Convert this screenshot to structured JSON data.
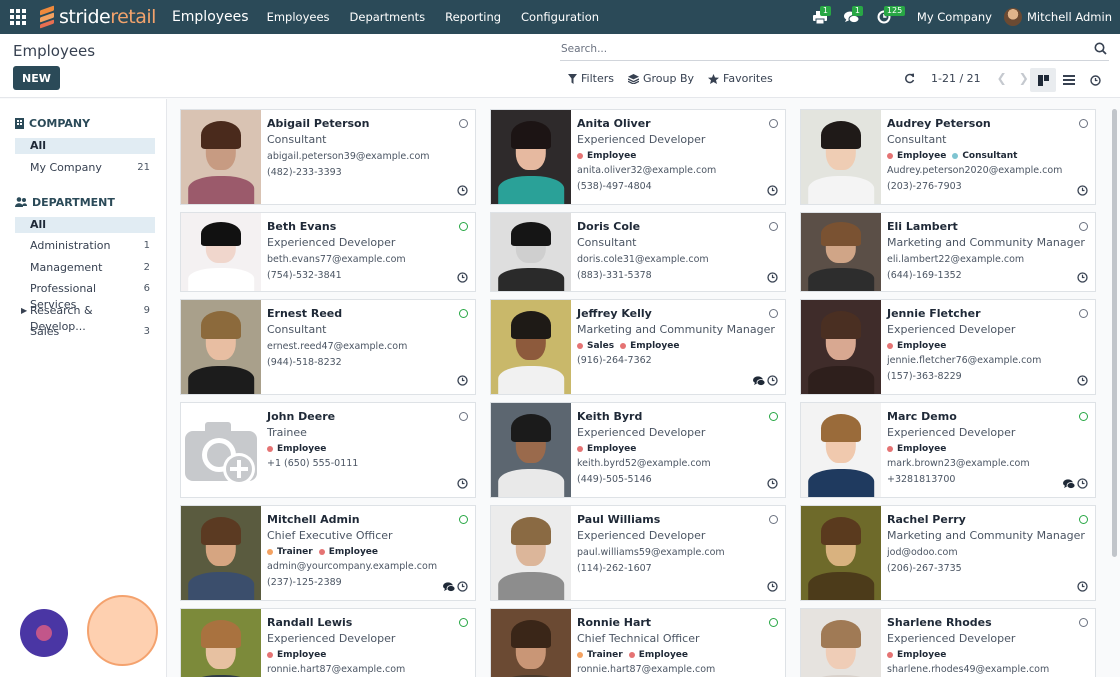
{
  "navbar": {
    "brand_a": "stride",
    "brand_b": "retail",
    "app_name": "Employees",
    "menu": [
      "Employees",
      "Departments",
      "Reporting",
      "Configuration"
    ],
    "badges": {
      "printer": "1",
      "messages": "1",
      "activities": "125"
    },
    "company": "My Company",
    "user": "Mitchell Admin"
  },
  "control_panel": {
    "breadcrumb": "Employees",
    "new_label": "NEW",
    "search_placeholder": "Search...",
    "filters_label": "Filters",
    "group_by_label": "Group By",
    "favorites_label": "Favorites",
    "pager_value": "1-21 / 21"
  },
  "sidebar": {
    "company": {
      "title": "COMPANY",
      "items": [
        {
          "label": "All",
          "count": ""
        },
        {
          "label": "My Company",
          "count": "21"
        }
      ]
    },
    "department": {
      "title": "DEPARTMENT",
      "items": [
        {
          "label": "All",
          "count": ""
        },
        {
          "label": "Administration",
          "count": "1"
        },
        {
          "label": "Management",
          "count": "2"
        },
        {
          "label": "Professional Services",
          "count": "6"
        },
        {
          "label": "Research & Develop...",
          "count": "9"
        },
        {
          "label": "Sales",
          "count": "3"
        }
      ]
    }
  },
  "colors": {
    "navbar": "#2b4a58",
    "tag_employee": "#e57373",
    "tag_consultant": "#7ec4d1",
    "tag_trainer": "#f4a261",
    "tag_sales": "#e57373",
    "online": "#28a745"
  },
  "employees": [
    {
      "name": "Abigail Peterson",
      "job": "Consultant",
      "tags": [],
      "email": "abigail.peterson39@example.com",
      "phone": "(482)-233-3393",
      "online": false,
      "chat": false,
      "photo": [
        "#d9c3b3",
        "#4a2a1c",
        "#c79b82",
        "#9b5a6b"
      ]
    },
    {
      "name": "Anita Oliver",
      "job": "Experienced Developer",
      "tags": [
        [
          "Employee",
          "tag_employee"
        ]
      ],
      "email": "anita.oliver32@example.com",
      "phone": "(538)-497-4804",
      "online": false,
      "chat": false,
      "photo": [
        "#2e2a2b",
        "#1c1414",
        "#e6b9a0",
        "#2aa198"
      ]
    },
    {
      "name": "Audrey Peterson",
      "job": "Consultant",
      "tags": [
        [
          "Employee",
          "tag_employee"
        ],
        [
          "Consultant",
          "tag_consultant"
        ]
      ],
      "email": "Audrey.peterson2020@example.com",
      "phone": "(203)-276-7903",
      "online": false,
      "chat": false,
      "photo": [
        "#e3e4de",
        "#1f1a18",
        "#efcdb4",
        "#f4f4f4"
      ]
    },
    {
      "name": "Beth Evans",
      "job": "Experienced Developer",
      "tags": [],
      "email": "beth.evans77@example.com",
      "phone": "(754)-532-3841",
      "online": true,
      "chat": false,
      "photo": [
        "#f4f1f2",
        "#111111",
        "#f0d6cc",
        "#ffffff"
      ]
    },
    {
      "name": "Doris Cole",
      "job": "Consultant",
      "tags": [],
      "email": "doris.cole31@example.com",
      "phone": "(883)-331-5378",
      "online": false,
      "chat": false,
      "photo": [
        "#dedede",
        "#151515",
        "#cfcfcf",
        "#2a2a2a"
      ]
    },
    {
      "name": "Eli Lambert",
      "job": "Marketing and Community Manager",
      "tags": [],
      "email": "eli.lambert22@example.com",
      "phone": "(644)-169-1352",
      "online": false,
      "chat": false,
      "photo": [
        "#5b4f47",
        "#7a5232",
        "#d0a587",
        "#2d2d2d"
      ]
    },
    {
      "name": "Ernest Reed",
      "job": "Consultant",
      "tags": [],
      "email": "ernest.reed47@example.com",
      "phone": "(944)-518-8232",
      "online": true,
      "chat": false,
      "photo": [
        "#a9a08b",
        "#8c6a3c",
        "#e8bea2",
        "#1c1c1c"
      ]
    },
    {
      "name": "Jeffrey Kelly",
      "job": "Marketing and Community Manager",
      "tags": [
        [
          "Sales",
          "tag_sales"
        ],
        [
          "Employee",
          "tag_employee"
        ]
      ],
      "email": "",
      "phone": "(916)-264-7362",
      "online": false,
      "chat": true,
      "photo": [
        "#c9b86a",
        "#1e1a16",
        "#8d5a3c",
        "#f1f1f1"
      ]
    },
    {
      "name": "Jennie Fletcher",
      "job": "Experienced Developer",
      "tags": [
        [
          "Employee",
          "tag_employee"
        ]
      ],
      "email": "jennie.fletcher76@example.com",
      "phone": "(157)-363-8229",
      "online": false,
      "chat": false,
      "photo": [
        "#3f2c2a",
        "#4a2f22",
        "#d8a891",
        "#2e1f1c"
      ]
    },
    {
      "name": "John Deere",
      "job": "Trainee",
      "tags": [
        [
          "Employee",
          "tag_employee"
        ]
      ],
      "email": "",
      "phone": "+1 (650) 555-0111",
      "online": false,
      "chat": false,
      "photo": null
    },
    {
      "name": "Keith Byrd",
      "job": "Experienced Developer",
      "tags": [
        [
          "Employee",
          "tag_employee"
        ]
      ],
      "email": "keith.byrd52@example.com",
      "phone": "(449)-505-5146",
      "online": true,
      "chat": false,
      "photo": [
        "#5c6670",
        "#1b1b1b",
        "#9a6a4c",
        "#e9e9e9"
      ]
    },
    {
      "name": "Marc Demo",
      "job": "Experienced Developer",
      "tags": [
        [
          "Employee",
          "tag_employee"
        ]
      ],
      "email": "mark.brown23@example.com",
      "phone": "+3281813700",
      "online": true,
      "chat": true,
      "photo": [
        "#f3f3f3",
        "#9a6b3a",
        "#f0c9ae",
        "#1f3a5f"
      ]
    },
    {
      "name": "Mitchell Admin",
      "job": "Chief Executive Officer",
      "tags": [
        [
          "Trainer",
          "tag_trainer"
        ],
        [
          "Employee",
          "tag_employee"
        ]
      ],
      "email": "admin@yourcompany.example.com",
      "phone": "(237)-125-2389",
      "online": true,
      "chat": true,
      "photo": [
        "#5a5b3f",
        "#5b3a22",
        "#d6a581",
        "#3b4e6c"
      ]
    },
    {
      "name": "Paul Williams",
      "job": "Experienced Developer",
      "tags": [],
      "email": "paul.williams59@example.com",
      "phone": "(114)-262-1607",
      "online": false,
      "chat": false,
      "photo": [
        "#ececec",
        "#8a6a43",
        "#dcb69a",
        "#8d8d8d"
      ]
    },
    {
      "name": "Rachel Perry",
      "job": "Marketing and Community Manager",
      "tags": [],
      "email": "jod@odoo.com",
      "phone": "(206)-267-3735",
      "online": true,
      "chat": false,
      "photo": [
        "#6e6a2a",
        "#5a3a1e",
        "#d9b27f",
        "#4c3b1a"
      ]
    },
    {
      "name": "Randall Lewis",
      "job": "Experienced Developer",
      "tags": [
        [
          "Employee",
          "tag_employee"
        ]
      ],
      "email": "ronnie.hart87@example.com",
      "phone": "",
      "online": true,
      "chat": false,
      "photo": [
        "#7c8a3a",
        "#a9723f",
        "#e7c1a1",
        "#2f3b47"
      ]
    },
    {
      "name": "Ronnie Hart",
      "job": "Chief Technical Officer",
      "tags": [
        [
          "Trainer",
          "tag_trainer"
        ],
        [
          "Employee",
          "tag_employee"
        ]
      ],
      "email": "ronnie.hart87@example.com",
      "phone": "",
      "online": true,
      "chat": false,
      "photo": [
        "#6b4a33",
        "#3a2618",
        "#c99676",
        "#4a3a2c"
      ]
    },
    {
      "name": "Sharlene Rhodes",
      "job": "Experienced Developer",
      "tags": [
        [
          "Employee",
          "tag_employee"
        ]
      ],
      "email": "sharlene.rhodes49@example.com",
      "phone": "",
      "online": false,
      "chat": false,
      "photo": [
        "#e6e3df",
        "#a07a55",
        "#efcdb7",
        "#d9d2cc"
      ]
    }
  ]
}
